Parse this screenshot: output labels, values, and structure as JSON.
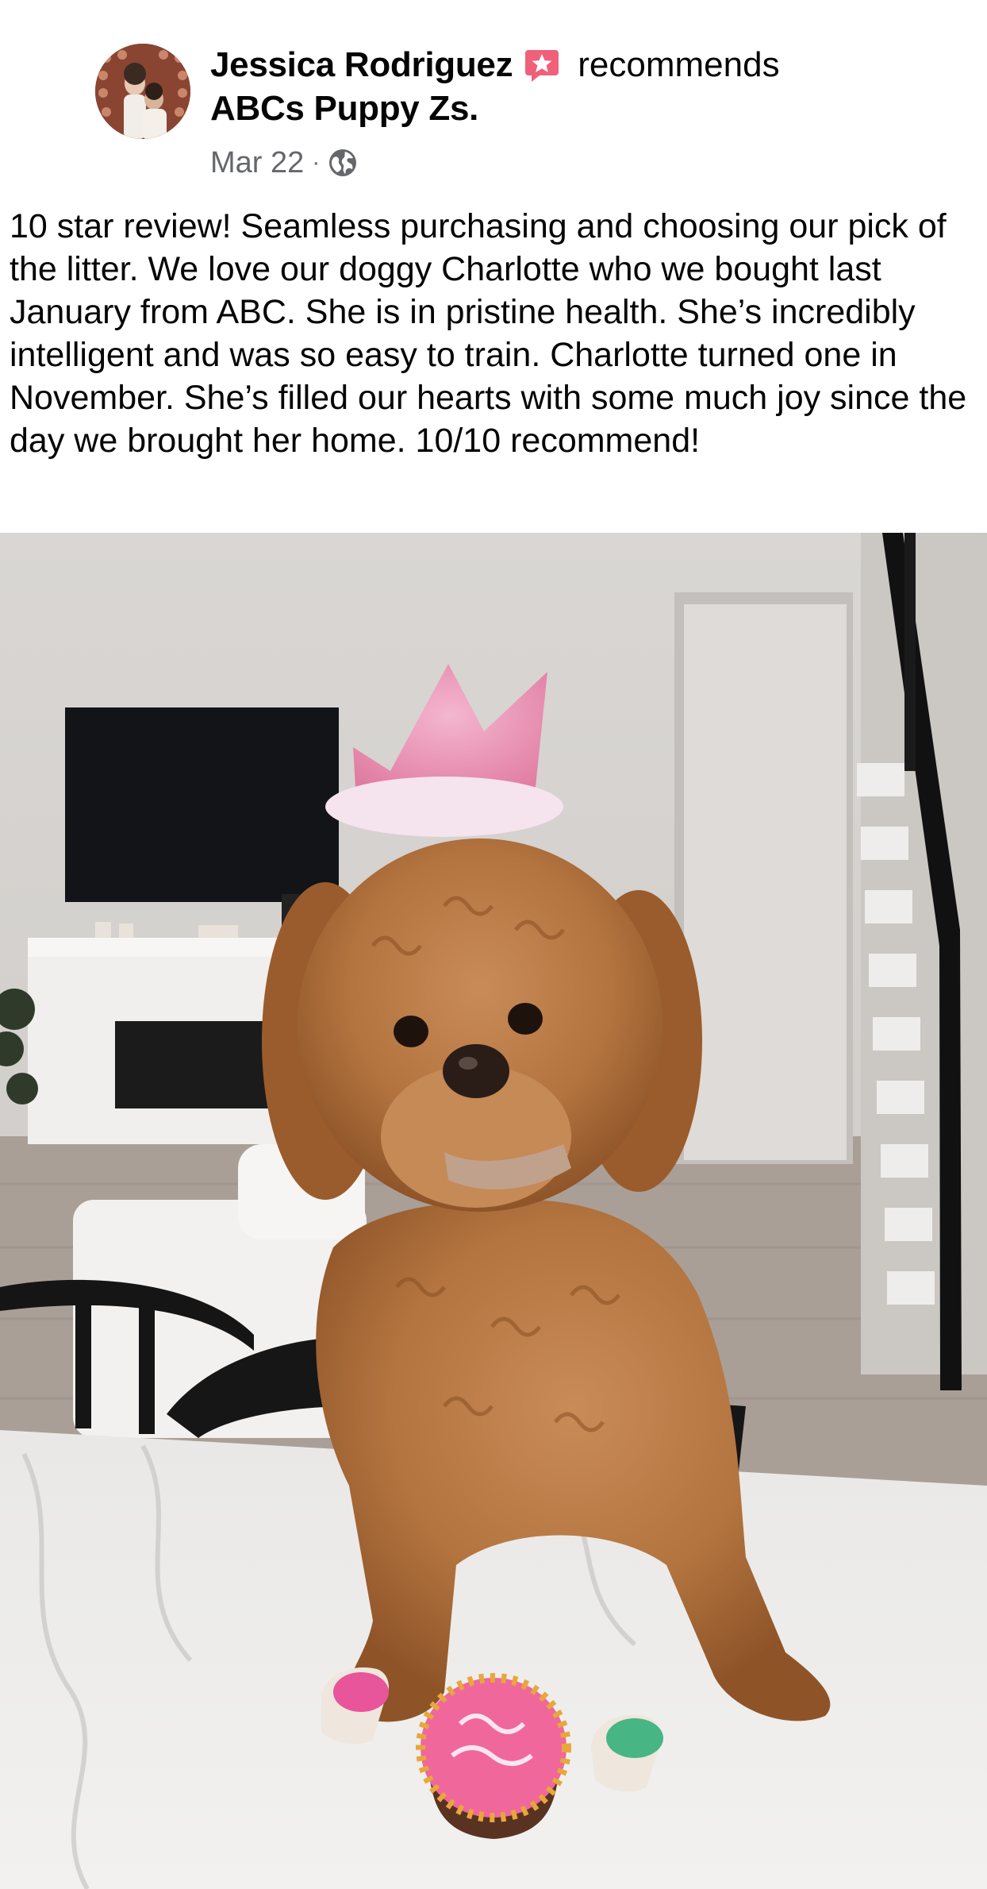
{
  "post": {
    "author": "Jessica Rodriguez",
    "verb": "recommends",
    "page": "ABCs Puppy Zs.",
    "date": "Mar 22",
    "separator": "·",
    "audience_icon": "globe-icon",
    "badge_icon": "recommend-star-icon",
    "text": "10 star review! Seamless purchasing and choosing our pick of the litter. We love our doggy Charlotte who we bought last January from ABC. She is in pristine health. She’s incredibly intelligent and was so easy to train. Charlotte turned one in November. She’s filled our hearts with some much joy since the day we brought her home. 10/10 recommend!"
  },
  "colors": {
    "badge": "#f0607a",
    "meta_text": "#65676b",
    "text": "#050505"
  }
}
